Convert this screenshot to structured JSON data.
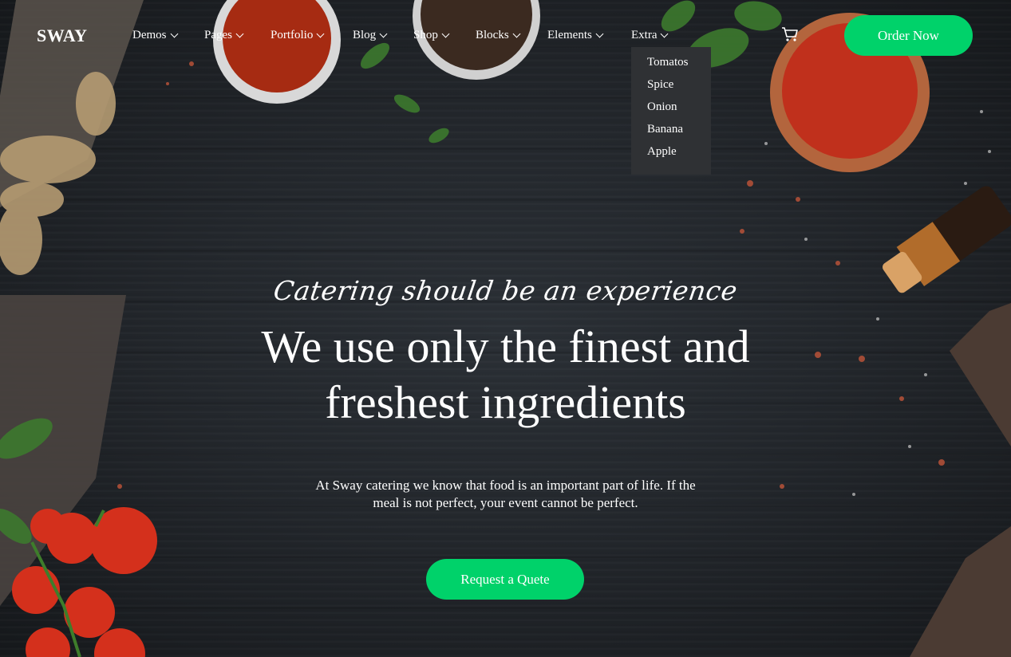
{
  "brand": {
    "name": "SWAY"
  },
  "nav": {
    "items": [
      {
        "label": "Demos",
        "has_dropdown": true
      },
      {
        "label": "Pages",
        "has_dropdown": true
      },
      {
        "label": "Portfolio",
        "has_dropdown": true
      },
      {
        "label": "Blog",
        "has_dropdown": true
      },
      {
        "label": "Shop",
        "has_dropdown": true
      },
      {
        "label": "Blocks",
        "has_dropdown": true
      },
      {
        "label": "Elements",
        "has_dropdown": true
      },
      {
        "label": "Extra",
        "has_dropdown": true
      }
    ],
    "cart_icon": "cart-icon",
    "order_button": "Order Now"
  },
  "dropdown": {
    "parent": "Extra",
    "items": [
      "Tomatos",
      "Spice",
      "Onion",
      "Banana",
      "Apple"
    ]
  },
  "hero": {
    "tagline": "Catering should be an experience",
    "headline_line1": "We use only the finest and",
    "headline_line2": "freshest ingredients",
    "text_line1": "At Sway catering we know that food is an important part of life. If the",
    "text_line2": "meal is not perfect, your event cannot be perfect.",
    "cta": "Request a Quete"
  },
  "colors": {
    "accent": "#00d26a",
    "background": "#23272c",
    "dropdown_bg": "#2f3134",
    "text": "#ffffff"
  }
}
